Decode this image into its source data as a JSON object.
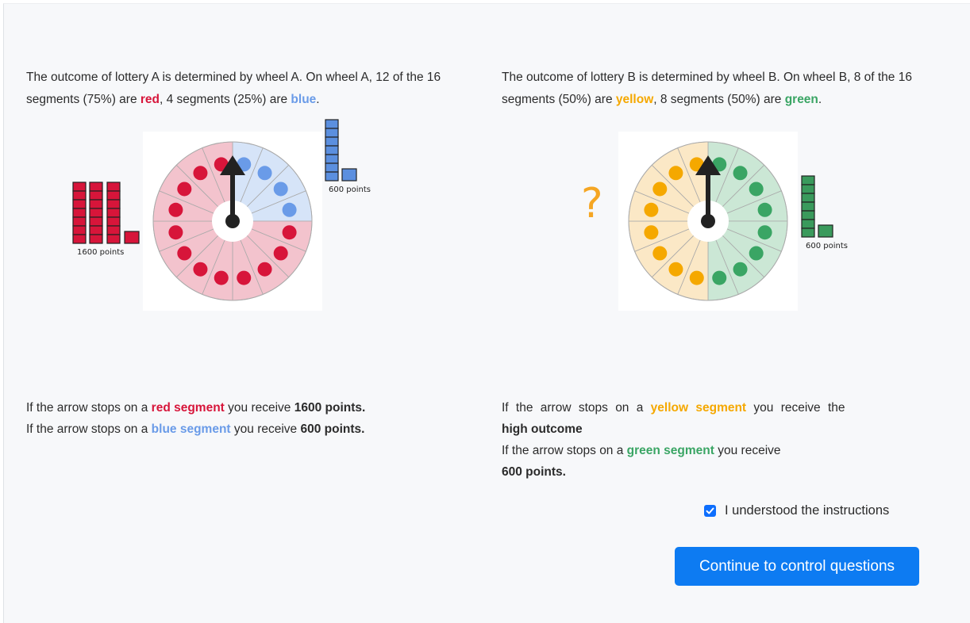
{
  "lotteryA": {
    "desc_part1": "The outcome of lottery A is determined by wheel A. On wheel A, 12 of the 16 segments (75%) are ",
    "color1": "red",
    "desc_part2": ", 4 segments (25%) are ",
    "color2": "blue",
    "desc_part3": ".",
    "high_label": "1600 points",
    "low_label": "600 points",
    "outcome_line1_pre": "If the arrow stops on a ",
    "outcome_line1_color": "red segment",
    "outcome_line1_mid": " you receive ",
    "outcome_line1_value": "1600 points.",
    "outcome_line2_pre": "If the arrow stops on a ",
    "outcome_line2_color": "blue segment",
    "outcome_line2_mid": " you receive ",
    "outcome_line2_value": "600 points."
  },
  "lotteryB": {
    "desc_part1": "The outcome of lottery B is determined by wheel B. On wheel B, 8 of the 16 segments (50%) are ",
    "color1": "yellow",
    "desc_part2": ", 8 segments (50%) are ",
    "color2": "green",
    "desc_part3": ".",
    "unknown_symbol": "?",
    "low_label": "600 points",
    "outcome_line1_pre": "If the arrow stops on a ",
    "outcome_line1_color": "yellow segment",
    "outcome_line1_mid": " you receive the ",
    "outcome_line1_value": "high outcome",
    "outcome_line2_pre": "If the arrow stops on a ",
    "outcome_line2_color": "green segment",
    "outcome_line2_mid": " you receive ",
    "outcome_line2_value": "600 points."
  },
  "confirm": {
    "checked": true,
    "label": "I understood the instructions"
  },
  "continue_button": "Continue to control questions",
  "colors": {
    "red": "#d7153a",
    "blue": "#6a9be8",
    "yellow": "#f5a800",
    "green": "#3aa564",
    "button": "#0d7bf2"
  },
  "icons": {
    "checkbox": "check-icon",
    "arrow": "arrow-up-icon"
  }
}
